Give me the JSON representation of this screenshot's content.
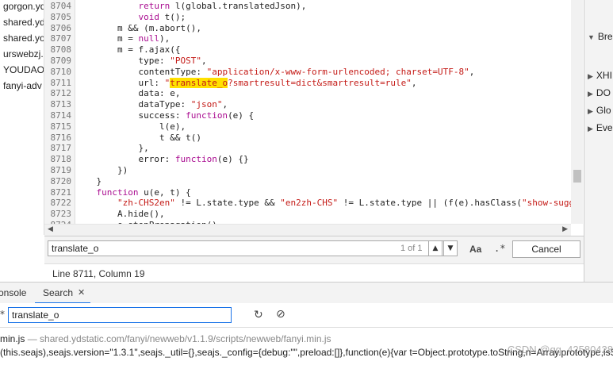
{
  "file_list": [
    "gorgon.yd",
    "shared.yd",
    "shared.yo",
    "urswebzj.",
    "YOUDAO_",
    "fanyi-adv"
  ],
  "code": {
    "lines": [
      {
        "n": "8704",
        "tokens": [
          {
            "t": "            "
          },
          {
            "t": "return",
            "c": "kw"
          },
          {
            "t": " l(global.translatedJson),"
          }
        ]
      },
      {
        "n": "8705",
        "tokens": [
          {
            "t": "            "
          },
          {
            "t": "void",
            "c": "kw"
          },
          {
            "t": " t();"
          }
        ]
      },
      {
        "n": "8706",
        "tokens": [
          {
            "t": "        m && (m.abort(),"
          }
        ]
      },
      {
        "n": "8707",
        "tokens": [
          {
            "t": "        m = "
          },
          {
            "t": "null",
            "c": "kw"
          },
          {
            "t": "),"
          }
        ]
      },
      {
        "n": "8708",
        "tokens": [
          {
            "t": "        m = f.ajax({"
          }
        ]
      },
      {
        "n": "8709",
        "tokens": [
          {
            "t": "            type: "
          },
          {
            "t": "\"POST\"",
            "c": "str"
          },
          {
            "t": ","
          }
        ]
      },
      {
        "n": "8710",
        "tokens": [
          {
            "t": "            contentType: "
          },
          {
            "t": "\"application/x-www-form-urlencoded; charset=UTF-8\"",
            "c": "str"
          },
          {
            "t": ","
          }
        ]
      },
      {
        "n": "8711",
        "tokens": [
          {
            "t": "            url: "
          },
          {
            "t": "\"",
            "c": "str"
          },
          {
            "t": "translate_o",
            "c": "str hl"
          },
          {
            "t": "?smartresult=dict&smartresult=rule\"",
            "c": "str"
          },
          {
            "t": ","
          }
        ]
      },
      {
        "n": "8712",
        "tokens": [
          {
            "t": "            data: e,"
          }
        ]
      },
      {
        "n": "8713",
        "tokens": [
          {
            "t": "            dataType: "
          },
          {
            "t": "\"json\"",
            "c": "str"
          },
          {
            "t": ","
          }
        ]
      },
      {
        "n": "8714",
        "tokens": [
          {
            "t": "            success: "
          },
          {
            "t": "function",
            "c": "kw"
          },
          {
            "t": "(e) {"
          }
        ]
      },
      {
        "n": "8715",
        "tokens": [
          {
            "t": "                l(e),"
          }
        ]
      },
      {
        "n": "8716",
        "tokens": [
          {
            "t": "                t && t()"
          }
        ]
      },
      {
        "n": "8717",
        "tokens": [
          {
            "t": "            },"
          }
        ]
      },
      {
        "n": "8718",
        "tokens": [
          {
            "t": "            error: "
          },
          {
            "t": "function",
            "c": "kw"
          },
          {
            "t": "(e) {}"
          }
        ]
      },
      {
        "n": "8719",
        "tokens": [
          {
            "t": "        })"
          }
        ]
      },
      {
        "n": "8720",
        "tokens": [
          {
            "t": "    }"
          }
        ]
      },
      {
        "n": "8721",
        "tokens": [
          {
            "t": "    "
          },
          {
            "t": "function",
            "c": "kw"
          },
          {
            "t": " u(e, t) {"
          }
        ]
      },
      {
        "n": "8722",
        "tokens": [
          {
            "t": "        "
          },
          {
            "t": "\"zh-CHS2en\"",
            "c": "str"
          },
          {
            "t": " != L.state.type && "
          },
          {
            "t": "\"en2zh-CHS\"",
            "c": "str"
          },
          {
            "t": " != L.state.type || (f(e).hasClass("
          },
          {
            "t": "\"show-sugg",
            "c": "str"
          }
        ]
      },
      {
        "n": "8723",
        "tokens": [
          {
            "t": "        A.hide(),"
          }
        ]
      },
      {
        "n": "8724",
        "tokens": [
          {
            "t": "        e.stopPropagation(),"
          }
        ]
      }
    ]
  },
  "right_pane": {
    "items": [
      {
        "label": "Bre",
        "arrow": "▼"
      },
      {
        "label": "XHI",
        "arrow": "▶"
      },
      {
        "label": "DO",
        "arrow": "▶"
      },
      {
        "label": "Glo",
        "arrow": "▶"
      },
      {
        "label": "Eve",
        "arrow": "▶"
      }
    ]
  },
  "find_bar": {
    "query": "translate_o",
    "match_count": "1 of 1",
    "case_label": "Aa",
    "regex_label": ".*",
    "cancel_label": "Cancel"
  },
  "status": {
    "text": "Line 8711, Column 19"
  },
  "drawer": {
    "tab_console": "onsole",
    "tab_search": "Search"
  },
  "search_panel": {
    "query": "translate_o",
    "result_file": "min.js",
    "result_path": "— shared.ydstatic.com/fanyi/newweb/v1.1.9/scripts/newweb/fanyi.min.js",
    "result_line": "(this.seajs),seajs.version=\"1.3.1\",seajs._util={},seajs._config={debug:\"\",preload:[]},function(e){var t=Object.prototype.toString,n=Array.prototype,isSt",
    "watermark": "CSDN @qq_42580428"
  }
}
